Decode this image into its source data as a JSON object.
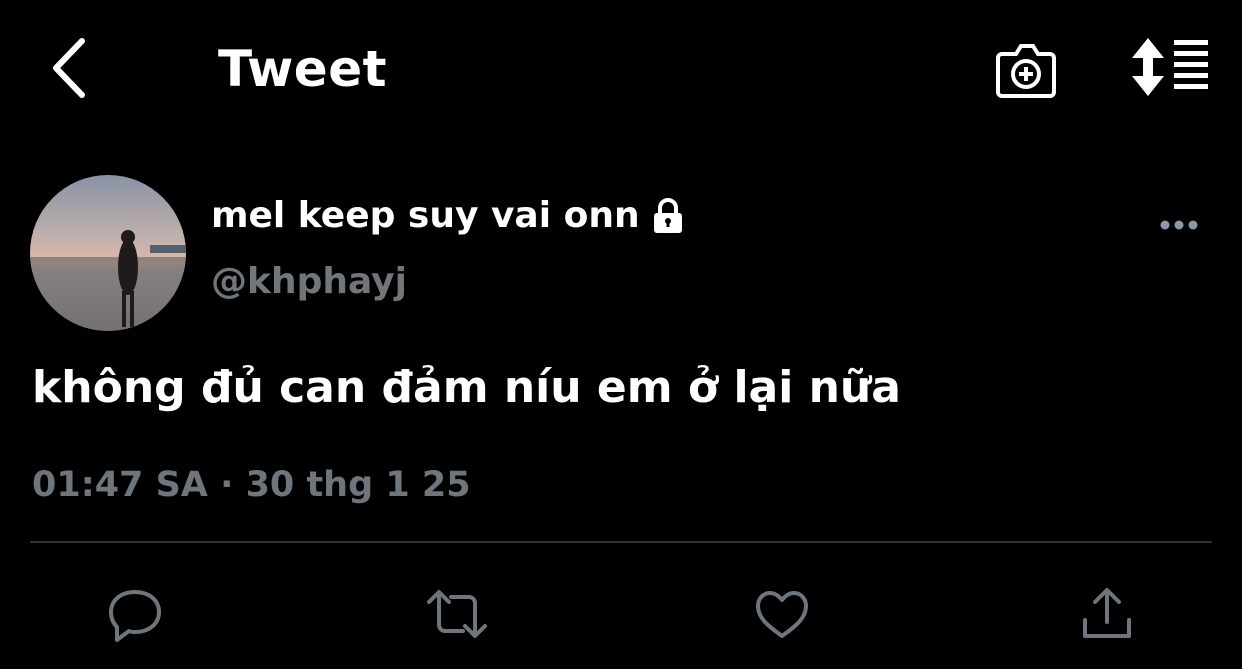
{
  "header": {
    "title": "Tweet",
    "back_icon": "chevron-left-icon",
    "camera_icon": "camera-plus-icon",
    "sort_icon": "sort-icon"
  },
  "tweet": {
    "author": {
      "display_name": "mel keep suy vai onn",
      "handle": "@khphayj",
      "protected_icon": "lock-icon"
    },
    "more_icon": "more-horizontal-icon",
    "text": "không đủ can đảm níu em ở lại nữa",
    "time": "01:47 SA",
    "separator": "·",
    "date": "30 thg 1 25"
  },
  "actions": {
    "reply_icon": "reply-icon",
    "retweet_icon": "retweet-icon",
    "like_icon": "heart-icon",
    "share_icon": "share-icon"
  },
  "colors": {
    "background": "#000000",
    "text": "#ffffff",
    "secondary_text": "#71767b",
    "divider": "#2f3336",
    "icon": "#6e767d"
  }
}
